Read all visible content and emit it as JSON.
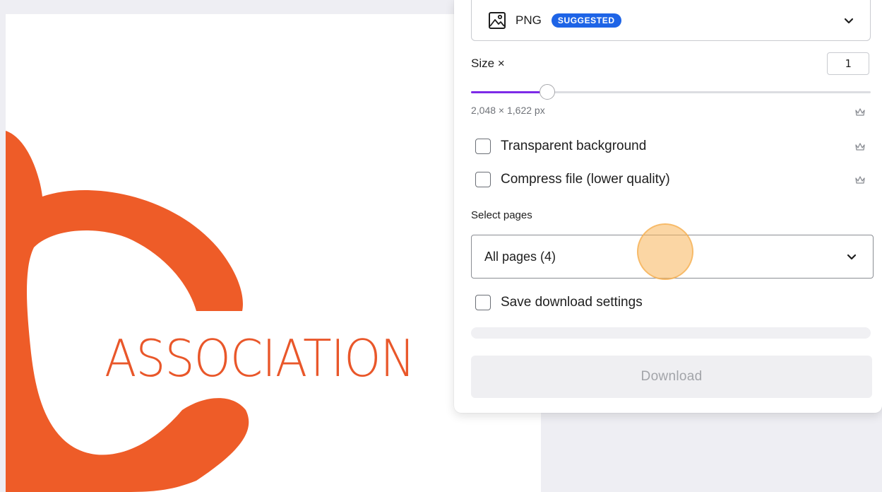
{
  "canvas": {
    "logo_text": "ASSOCIATION",
    "brand_color": "#e9572a"
  },
  "panel": {
    "file_type": {
      "label": "PNG",
      "badge": "SUGGESTED",
      "icon": "image-icon"
    },
    "size": {
      "label": "Size ×",
      "value": "1",
      "slider_fraction": 0.19,
      "dimensions": "2,048 × 1,622 px"
    },
    "options": [
      {
        "label": "Transparent background",
        "checked": false,
        "premium": true
      },
      {
        "label": "Compress file (lower quality)",
        "checked": false,
        "premium": true
      }
    ],
    "select_pages": {
      "label": "Select pages",
      "value": "All pages (4)"
    },
    "save_settings": {
      "label": "Save download settings",
      "checked": false
    },
    "download_label": "Download",
    "accent_color": "#7d2ae8",
    "badge_color": "#1e64e6"
  }
}
